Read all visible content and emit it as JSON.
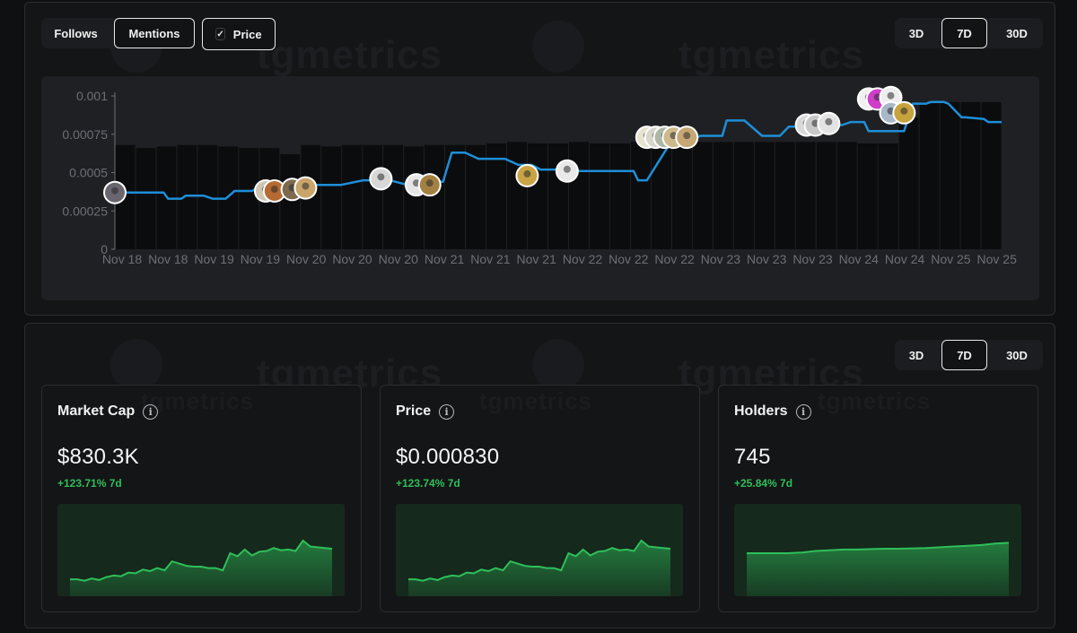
{
  "top_panel": {
    "filters": [
      {
        "label": "Follows",
        "active": false
      },
      {
        "label": "Mentions",
        "active": true
      },
      {
        "label": "Price",
        "active": true,
        "checked": true
      }
    ],
    "range_buttons": [
      {
        "label": "3D",
        "active": false
      },
      {
        "label": "7D",
        "active": true
      },
      {
        "label": "30D",
        "active": false
      }
    ],
    "watermark": "tgmetrics"
  },
  "chart_data": {
    "type": "line",
    "title": "",
    "xlabel": "",
    "ylabel": "",
    "ylim": [
      0,
      0.001
    ],
    "y_ticks": [
      "0.001",
      "0.00075",
      "0.0005",
      "0.00025",
      "0"
    ],
    "x_tick_labels": [
      "Nov 18",
      "Nov 18",
      "Nov 19",
      "Nov 19",
      "Nov 20",
      "Nov 20",
      "Nov 20",
      "Nov 21",
      "Nov 21",
      "Nov 21",
      "Nov 22",
      "Nov 22",
      "Nov 22",
      "Nov 23",
      "Nov 23",
      "Nov 23",
      "Nov 24",
      "Nov 24",
      "Nov 25",
      "Nov 25"
    ],
    "line_color": "#1e8fd8",
    "price_series_x": [
      0,
      0.055,
      0.06,
      0.075,
      0.08,
      0.1,
      0.11,
      0.125,
      0.135,
      0.155,
      0.16,
      0.215,
      0.225,
      0.255,
      0.28,
      0.31,
      0.33,
      0.345,
      0.355,
      0.37,
      0.38,
      0.395,
      0.41,
      0.44,
      0.455,
      0.47,
      0.48,
      0.5,
      0.52,
      0.55,
      0.57,
      0.585,
      0.59,
      0.6,
      0.625,
      0.64,
      0.66,
      0.685,
      0.69,
      0.71,
      0.73,
      0.75,
      0.76,
      0.785,
      0.79,
      0.82,
      0.83,
      0.845,
      0.85,
      0.865,
      0.87,
      0.89,
      0.9,
      0.915,
      0.92,
      0.935,
      0.94,
      0.955,
      0.96,
      0.98,
      0.985,
      1
    ],
    "price_series_y": [
      0.00037,
      0.00037,
      0.00033,
      0.00033,
      0.00035,
      0.00035,
      0.00033,
      0.00033,
      0.00038,
      0.00038,
      0.0004,
      0.0004,
      0.00042,
      0.00042,
      0.00045,
      0.00045,
      0.00042,
      0.00042,
      0.00044,
      0.00044,
      0.00063,
      0.00063,
      0.00059,
      0.00059,
      0.00055,
      0.00055,
      0.00052,
      0.00052,
      0.00051,
      0.00051,
      0.00051,
      0.00051,
      0.00045,
      0.00045,
      0.00068,
      0.00068,
      0.00074,
      0.00074,
      0.00084,
      0.00084,
      0.00074,
      0.00074,
      0.0008,
      0.0008,
      0.00081,
      0.00081,
      0.00083,
      0.00083,
      0.00077,
      0.00077,
      0.00077,
      0.00077,
      0.00095,
      0.00095,
      0.00096,
      0.00096,
      0.00095,
      0.00086,
      0.00086,
      0.00085,
      0.00083,
      0.00083
    ],
    "volume_bars_y": [
      0.00068,
      0.00066,
      0.00067,
      0.00068,
      0.00068,
      0.00067,
      0.00066,
      0.00066,
      0.00062,
      0.00068,
      0.00067,
      0.00068,
      0.00068,
      0.00068,
      0.00067,
      0.00068,
      0.00068,
      0.00068,
      0.00069,
      0.0007,
      0.00069,
      0.00069,
      0.0007,
      0.00069,
      0.00069,
      0.0007,
      0.00071,
      0.0007,
      0.0007,
      0.0007,
      0.0007,
      0.0007,
      0.0007,
      0.0007,
      0.0007,
      0.0007,
      0.00069,
      0.00069,
      0.00086,
      0.00096,
      0.00096,
      0.00096,
      0.00096
    ],
    "mentions": [
      {
        "x": 0.0,
        "y": 0.00037,
        "color": "#6a6670"
      },
      {
        "x": 0.17,
        "y": 0.00038,
        "color": "#cfc6b4"
      },
      {
        "x": 0.18,
        "y": 0.00038,
        "color": "#b56a32"
      },
      {
        "x": 0.2,
        "y": 0.00039,
        "color": "#7d6a4f"
      },
      {
        "x": 0.215,
        "y": 0.0004,
        "color": "#c9a56b"
      },
      {
        "x": 0.3,
        "y": 0.00046,
        "color": "#d8d8d8"
      },
      {
        "x": 0.34,
        "y": 0.00042,
        "color": "#e5e5e5"
      },
      {
        "x": 0.355,
        "y": 0.00042,
        "color": "#a38142"
      },
      {
        "x": 0.465,
        "y": 0.00048,
        "color": "#c9a445"
      },
      {
        "x": 0.51,
        "y": 0.00051,
        "color": "#e9e9e9"
      },
      {
        "x": 0.6,
        "y": 0.00073,
        "color": "#e6e3cf"
      },
      {
        "x": 0.61,
        "y": 0.00073,
        "color": "#d7d5cc"
      },
      {
        "x": 0.62,
        "y": 0.00073,
        "color": "#aeb6a5"
      },
      {
        "x": 0.63,
        "y": 0.00073,
        "color": "#cdb98a"
      },
      {
        "x": 0.645,
        "y": 0.00073,
        "color": "#c7a774"
      },
      {
        "x": 0.78,
        "y": 0.00081,
        "color": "#d9d9d9"
      },
      {
        "x": 0.79,
        "y": 0.00081,
        "color": "#c8c8c8"
      },
      {
        "x": 0.805,
        "y": 0.00082,
        "color": "#e3e3e3"
      },
      {
        "x": 0.85,
        "y": 0.00098,
        "color": "#f0f0f0"
      },
      {
        "x": 0.86,
        "y": 0.00098,
        "color": "#cf3ec9"
      },
      {
        "x": 0.875,
        "y": 0.00099,
        "color": "#eeeeee"
      },
      {
        "x": 0.875,
        "y": 0.00089,
        "color": "#a9b8c9"
      },
      {
        "x": 0.89,
        "y": 0.00089,
        "color": "#c7a33f"
      }
    ]
  },
  "bottom_panel": {
    "range_buttons": [
      {
        "label": "3D",
        "active": false
      },
      {
        "label": "7D",
        "active": true
      },
      {
        "label": "30D",
        "active": false
      }
    ],
    "cards": [
      {
        "title": "Market Cap",
        "value": "$830.3K",
        "change": "+123.71% 7d",
        "spark": [
          0.18,
          0.18,
          0.16,
          0.19,
          0.17,
          0.21,
          0.23,
          0.22,
          0.27,
          0.26,
          0.31,
          0.29,
          0.33,
          0.3,
          0.42,
          0.39,
          0.36,
          0.35,
          0.35,
          0.33,
          0.33,
          0.3,
          0.53,
          0.49,
          0.58,
          0.5,
          0.55,
          0.56,
          0.6,
          0.57,
          0.58,
          0.56,
          0.7,
          0.62,
          0.61,
          0.6,
          0.59
        ]
      },
      {
        "title": "Price",
        "value": "$0.000830",
        "change": "+123.74% 7d",
        "spark": [
          0.18,
          0.18,
          0.16,
          0.19,
          0.17,
          0.21,
          0.23,
          0.22,
          0.27,
          0.26,
          0.31,
          0.29,
          0.33,
          0.3,
          0.42,
          0.39,
          0.36,
          0.35,
          0.35,
          0.33,
          0.33,
          0.3,
          0.53,
          0.49,
          0.58,
          0.5,
          0.55,
          0.56,
          0.6,
          0.57,
          0.58,
          0.56,
          0.7,
          0.62,
          0.61,
          0.6,
          0.59
        ]
      },
      {
        "title": "Holders",
        "value": "745",
        "change": "+25.84% 7d",
        "spark": [
          0.53,
          0.53,
          0.53,
          0.53,
          0.54,
          0.56,
          0.57,
          0.58,
          0.58,
          0.585,
          0.59,
          0.59,
          0.595,
          0.6,
          0.61,
          0.62,
          0.63,
          0.64,
          0.66,
          0.67
        ]
      }
    ],
    "watermark": "tgmetrics"
  },
  "colors": {
    "up": "#2fbf5a",
    "line": "#1e8fd8"
  },
  "icons": {
    "info": "info-circle-icon",
    "check": "checkmark-icon"
  }
}
